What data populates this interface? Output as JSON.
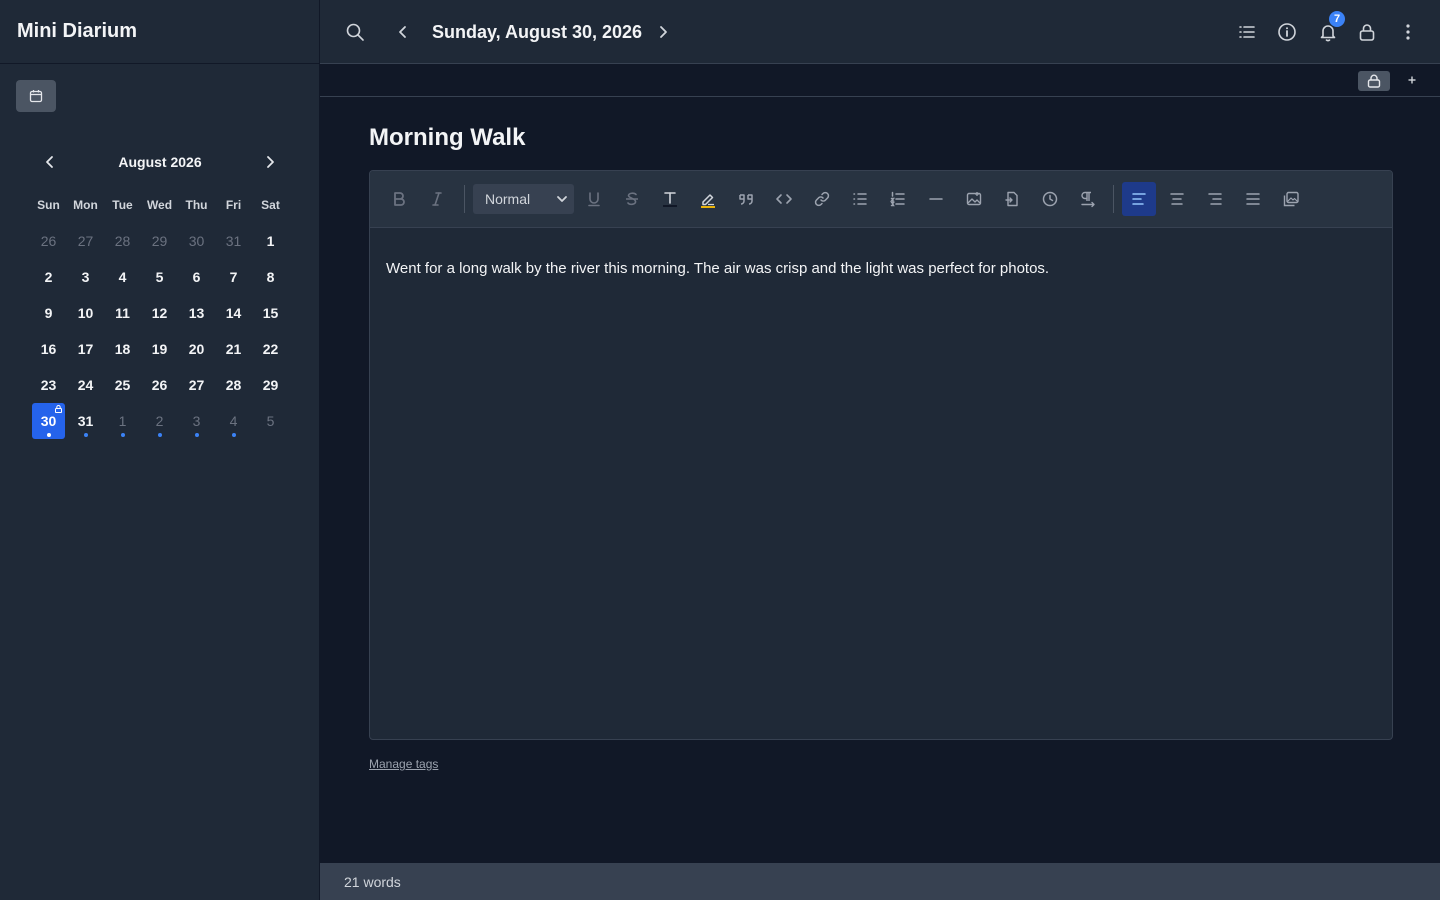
{
  "app": {
    "title": "Mini Diarium"
  },
  "calendar": {
    "month_label": "August 2026",
    "weekdays": [
      "Sun",
      "Mon",
      "Tue",
      "Wed",
      "Thu",
      "Fri",
      "Sat"
    ],
    "weeks": [
      [
        "26",
        "27",
        "28",
        "29",
        "30",
        "31",
        "1"
      ],
      [
        "2",
        "3",
        "4",
        "5",
        "6",
        "7",
        "8"
      ],
      [
        "9",
        "10",
        "11",
        "12",
        "13",
        "14",
        "15"
      ],
      [
        "16",
        "17",
        "18",
        "19",
        "20",
        "21",
        "22"
      ],
      [
        "23",
        "24",
        "25",
        "26",
        "27",
        "28",
        "29"
      ],
      [
        "30",
        "31",
        "1",
        "2",
        "3",
        "4",
        "5"
      ]
    ]
  },
  "header": {
    "date_title": "Sunday, August 30, 2026",
    "notification_count": "7"
  },
  "entry": {
    "title": "Morning Walk",
    "body": "Went for a long walk by the river this morning. The air was crisp and the light was perfect for photos."
  },
  "toolbar": {
    "format_value": "Normal"
  },
  "footer": {
    "manage_tags": "Manage tags",
    "word_count": "21 words"
  },
  "colors": {
    "accent": "#2563eb",
    "dot": "#3b82f6",
    "sidebar_bg": "#1f2937",
    "main_bg": "#111827",
    "highlight": "#eab308"
  }
}
